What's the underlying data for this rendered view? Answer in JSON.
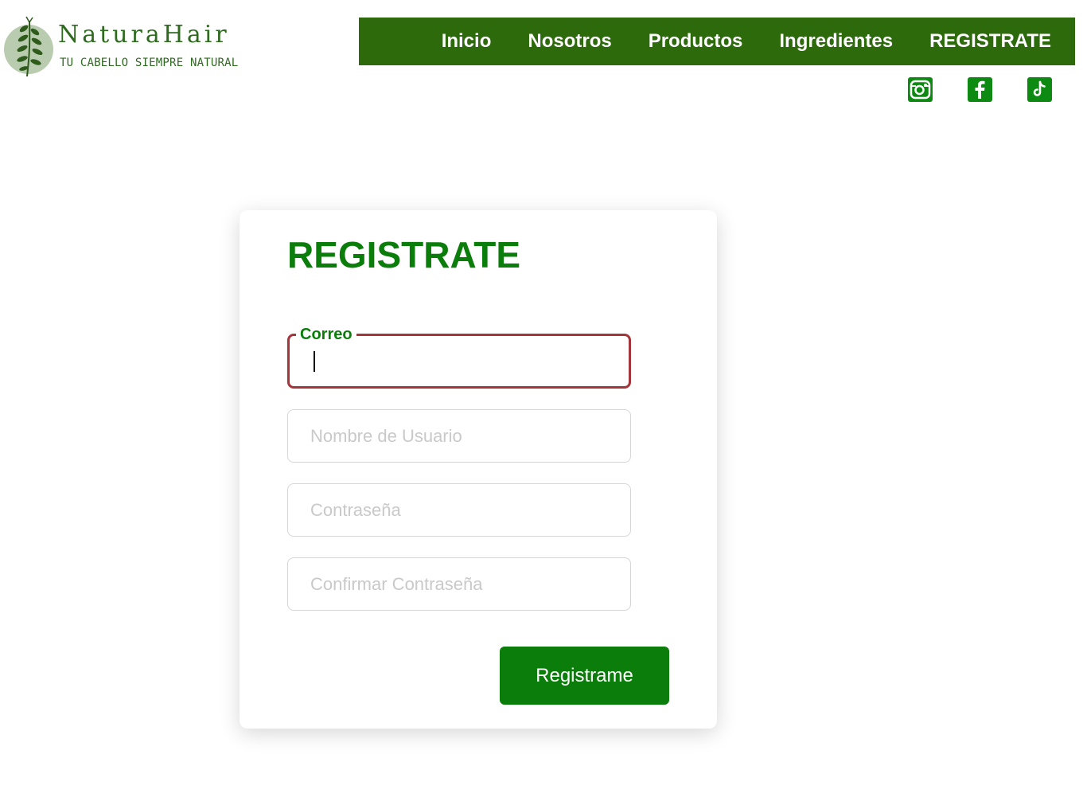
{
  "brand": {
    "name": "NaturaHair",
    "tagline": "TU CABELLO SIEMPRE NATURAL",
    "logo_icon": "leaf-branch-icon"
  },
  "nav": {
    "items": [
      {
        "label": "Inicio"
      },
      {
        "label": "Nosotros"
      },
      {
        "label": "Productos"
      },
      {
        "label": "Ingredientes"
      },
      {
        "label": "REGISTRATE"
      }
    ]
  },
  "social": [
    {
      "icon": "instagram-icon"
    },
    {
      "icon": "facebook-icon"
    },
    {
      "icon": "tiktok-icon"
    }
  ],
  "form": {
    "title": "REGISTRATE",
    "email": {
      "label": "Correo",
      "value": ""
    },
    "username": {
      "placeholder": "Nombre de Usuario",
      "value": ""
    },
    "password": {
      "placeholder": "Contraseña",
      "value": ""
    },
    "confirm_password": {
      "placeholder": "Confirmar Contraseña",
      "value": ""
    },
    "submit_label": "Registrame"
  },
  "colors": {
    "nav_bg": "#2d6a0c",
    "accent_green": "#0b7d0b",
    "focus_border": "#a5353a",
    "social_bg": "#0c8a12"
  }
}
